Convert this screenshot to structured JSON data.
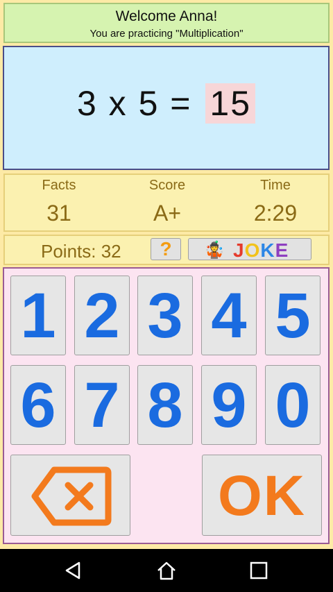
{
  "header": {
    "greeting": "Welcome Anna!",
    "subtitle": "You are practicing \"Multiplication\""
  },
  "question": {
    "operand_a": "3",
    "operator": "x",
    "operand_b": "5",
    "equals": "=",
    "answer": "15"
  },
  "stats": {
    "facts_label": "Facts",
    "facts_value": "31",
    "score_label": "Score",
    "score_value": "A+",
    "time_label": "Time",
    "time_value": "2:29"
  },
  "points_bar": {
    "points_label": "Points: 32",
    "help_label": "?",
    "joke_label": "JOKE"
  },
  "keypad": {
    "row1": [
      "1",
      "2",
      "3",
      "4",
      "5"
    ],
    "row2": [
      "6",
      "7",
      "8",
      "9",
      "0"
    ],
    "ok_label": "OK",
    "backspace_icon": "backspace-icon"
  },
  "colors": {
    "digit": "#1a6be0",
    "ok": "#f37a1d",
    "stat_text": "#8a6a16",
    "answer_bg": "#f7d6d8"
  },
  "navbar": {
    "icons": [
      "back-icon",
      "home-icon",
      "recents-icon"
    ]
  }
}
